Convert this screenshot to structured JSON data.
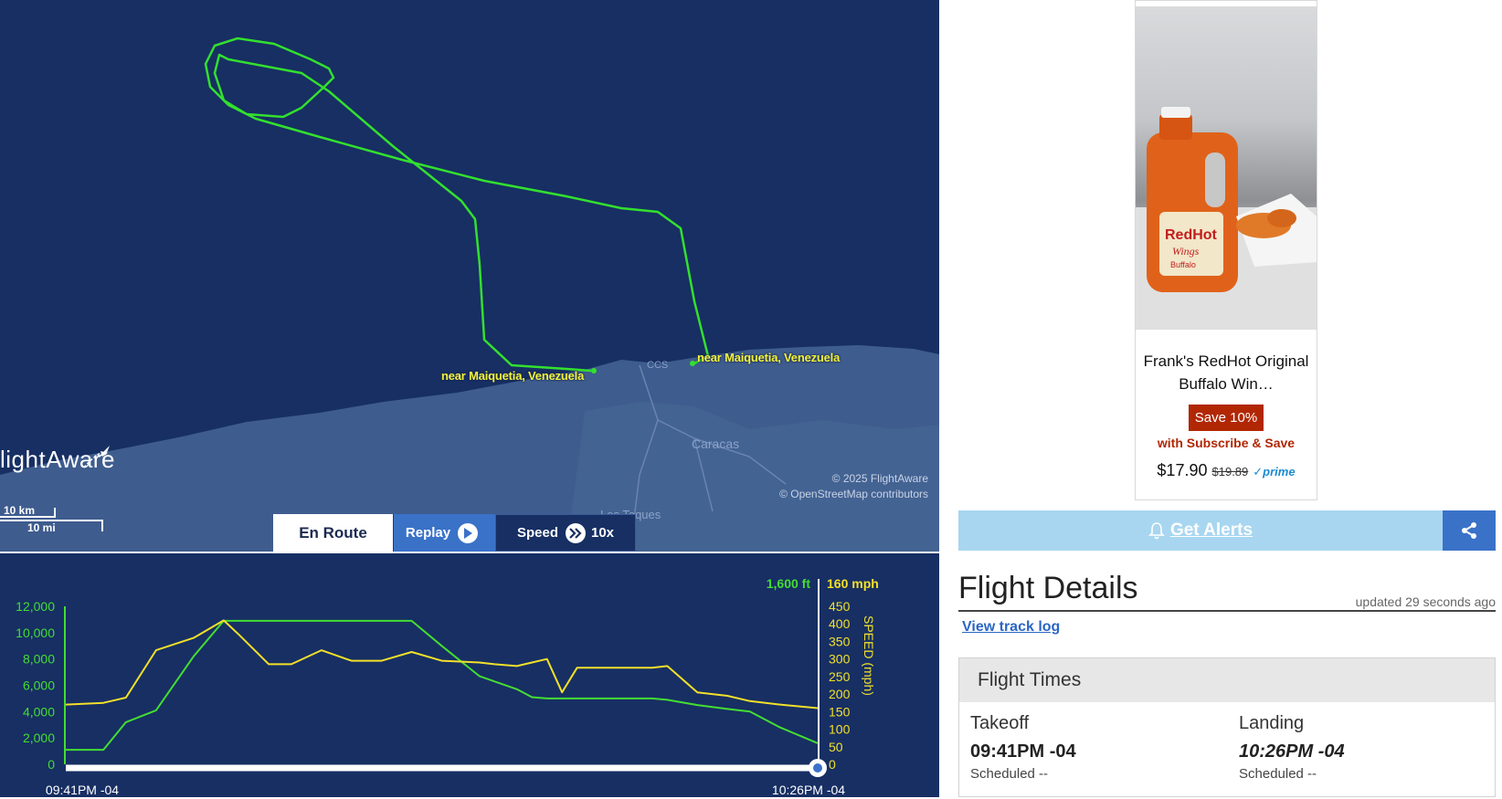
{
  "map": {
    "labels": {
      "origin": "near Maiquetia, Venezuela",
      "destination": "near Maiquetia, Venezuela",
      "city_caracas": "Caracas",
      "city_ccs": "CCS",
      "city_los_teques": "Los Teques"
    },
    "logo": "lightAware",
    "attribution_1": "© 2025 FlightAware",
    "attribution_2": "© OpenStreetMap contributors",
    "scale": {
      "km": "10 km",
      "mi": "10 mi"
    },
    "colors": {
      "ocean": "#172f63",
      "land": "#3e5c8e",
      "track": "#33e02e"
    }
  },
  "controls": {
    "en_route": "En Route",
    "replay": "Replay",
    "speed_label": "Speed",
    "speed_value": "10x"
  },
  "chart_data": {
    "type": "line",
    "x_start_label": "09:41PM -04",
    "x_end_label": "10:26PM -04",
    "left_axis": {
      "ticks": [
        "12,000",
        "10,000",
        "8,000",
        "6,000",
        "4,000",
        "2,000",
        "0"
      ],
      "ylim": [
        0,
        12000
      ],
      "current_label": "1,600 ft"
    },
    "right_axis": {
      "label": "SPEED (mph)",
      "ticks": [
        "450",
        "400",
        "350",
        "300",
        "250",
        "200",
        "150",
        "100",
        "50",
        "0"
      ],
      "ylim": [
        0,
        450
      ],
      "current_label": "160 mph"
    },
    "x": [
      0,
      0.05,
      0.08,
      0.12,
      0.17,
      0.21,
      0.23,
      0.27,
      0.3,
      0.34,
      0.38,
      0.42,
      0.46,
      0.5,
      0.55,
      0.57,
      0.6,
      0.62,
      0.64,
      0.66,
      0.68,
      0.69,
      0.71,
      0.75,
      0.78,
      0.8,
      0.84,
      0.88,
      0.91,
      0.95,
      1.0
    ],
    "series": [
      {
        "color": "#44dd33",
        "values": [
          1100,
          1100,
          3200,
          4100,
          8200,
          10900,
          10900,
          10900,
          10900,
          10900,
          10900,
          10900,
          10900,
          9000,
          6700,
          6300,
          5700,
          5100,
          5000,
          5000,
          5000,
          5000,
          5000,
          5000,
          5000,
          4900,
          4500,
          4200,
          4000,
          2800,
          1600
        ]
      },
      {
        "color": "#f2e02a",
        "values": [
          170,
          175,
          190,
          325,
          360,
          410,
          370,
          285,
          285,
          325,
          295,
          295,
          320,
          295,
          290,
          285,
          280,
          290,
          300,
          205,
          275,
          275,
          275,
          275,
          275,
          280,
          205,
          195,
          180,
          170,
          160
        ]
      }
    ],
    "colors": {
      "altitude": "#44dd33",
      "speed": "#f2e02a",
      "axis_left": "#44dd33",
      "axis_right": "#f2e02a"
    }
  },
  "sidebar": {
    "ad": {
      "image_brand": "RedHot",
      "image_sub1": "Wings",
      "image_sub2": "Buffalo",
      "title": "Frank's RedHot Original Buffalo Win…",
      "save_badge": "Save 10%",
      "subscribe": "with Subscribe & Save",
      "price": "$17.90",
      "old_price": "$19.89",
      "prime": "✓prime"
    },
    "alerts_button": "Get Alerts",
    "flight_details": {
      "title": "Flight Details",
      "updated": "updated 29 seconds ago",
      "track_link": "View track log"
    },
    "flight_times": {
      "heading": "Flight Times",
      "takeoff_label": "Takeoff",
      "takeoff_time": "09:41PM -04",
      "takeoff_sched": "Scheduled --",
      "landing_label": "Landing",
      "landing_time": "10:26PM -04",
      "landing_sched": "Scheduled --"
    }
  }
}
